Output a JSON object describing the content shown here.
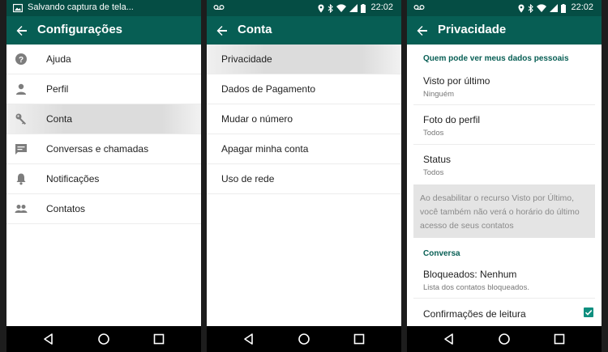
{
  "colors": {
    "status_bar": "#054d44",
    "toolbar": "#075e54",
    "accent": "#0f8f7f",
    "info_box": "#e4e4e4"
  },
  "screen1": {
    "notification_text": "Salvando captura de tela...",
    "title": "Configurações",
    "items": [
      {
        "label": "Ajuda",
        "icon": "help-icon"
      },
      {
        "label": "Perfil",
        "icon": "person-icon"
      },
      {
        "label": "Conta",
        "icon": "key-icon"
      },
      {
        "label": "Conversas e chamadas",
        "icon": "chat-icon"
      },
      {
        "label": "Notificações",
        "icon": "bell-icon"
      },
      {
        "label": "Contatos",
        "icon": "people-icon"
      }
    ]
  },
  "screen2": {
    "time": "22:02",
    "title": "Conta",
    "items": [
      {
        "label": "Privacidade"
      },
      {
        "label": "Dados de Pagamento"
      },
      {
        "label": "Mudar o número"
      },
      {
        "label": "Apagar minha conta"
      },
      {
        "label": "Uso de rede"
      }
    ]
  },
  "screen3": {
    "time": "22:02",
    "title": "Privacidade",
    "section_personal": "Quem pode ver meus dados pessoais",
    "last_seen": {
      "title": "Visto por último",
      "value": "Ninguém"
    },
    "profile_photo": {
      "title": "Foto do perfil",
      "value": "Todos"
    },
    "status": {
      "title": "Status",
      "value": "Todos"
    },
    "info_text": "Ao desabilitar o recurso Visto por Último, você também não verá o horário do último acesso de seus contatos",
    "section_chat": "Conversa",
    "blocked": {
      "title": "Bloqueados: Nenhum",
      "value": "Lista dos contatos bloqueados."
    },
    "read_receipts": {
      "title": "Confirmações de leitura",
      "checked": true
    }
  }
}
